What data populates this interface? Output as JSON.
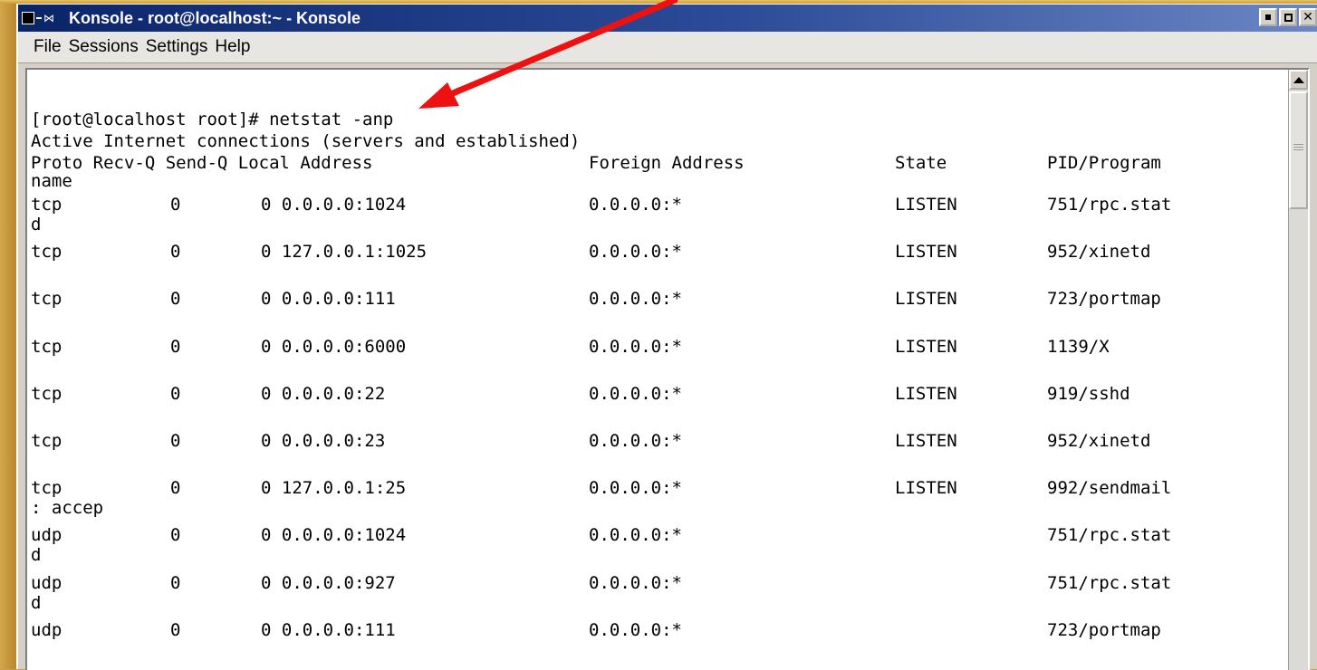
{
  "window": {
    "title": "Konsole - root@localhost:~ - Konsole",
    "title_icon_glyph": "⋈"
  },
  "menu": {
    "items": [
      "File",
      "Sessions",
      "Settings",
      "Help"
    ]
  },
  "terminal": {
    "prompt_line": "[root@localhost root]# netstat -anp",
    "header_line": "Active Internet connections (servers and established)",
    "column_headers": {
      "proto_recv_send_local": "Proto Recv-Q Send-Q Local Address",
      "foreign": "Foreign Address",
      "state": "State",
      "pid": "PID/Program"
    },
    "header_wrap": "name",
    "rows": [
      {
        "proto": "tcp",
        "recvq": "0",
        "sendq_local": "0 0.0.0.0:1024",
        "foreign": "0.0.0.0:*",
        "state": "LISTEN",
        "pid": "751/rpc.stat",
        "wrap": "d"
      },
      {
        "proto": "tcp",
        "recvq": "0",
        "sendq_local": "0 127.0.0.1:1025",
        "foreign": "0.0.0.0:*",
        "state": "LISTEN",
        "pid": "952/xinetd",
        "wrap": ""
      },
      {
        "proto": "tcp",
        "recvq": "0",
        "sendq_local": "0 0.0.0.0:111",
        "foreign": "0.0.0.0:*",
        "state": "LISTEN",
        "pid": "723/portmap",
        "wrap": ""
      },
      {
        "proto": "tcp",
        "recvq": "0",
        "sendq_local": "0 0.0.0.0:6000",
        "foreign": "0.0.0.0:*",
        "state": "LISTEN",
        "pid": "1139/X",
        "wrap": ""
      },
      {
        "proto": "tcp",
        "recvq": "0",
        "sendq_local": "0 0.0.0.0:22",
        "foreign": "0.0.0.0:*",
        "state": "LISTEN",
        "pid": "919/sshd",
        "wrap": ""
      },
      {
        "proto": "tcp",
        "recvq": "0",
        "sendq_local": "0 0.0.0.0:23",
        "foreign": "0.0.0.0:*",
        "state": "LISTEN",
        "pid": "952/xinetd",
        "wrap": ""
      },
      {
        "proto": "tcp",
        "recvq": "0",
        "sendq_local": "0 127.0.0.1:25",
        "foreign": "0.0.0.0:*",
        "state": "LISTEN",
        "pid": "992/sendmail",
        "wrap": ": accep"
      },
      {
        "proto": "udp",
        "recvq": "0",
        "sendq_local": "0 0.0.0.0:1024",
        "foreign": "0.0.0.0:*",
        "state": "",
        "pid": "751/rpc.stat",
        "wrap": "d"
      },
      {
        "proto": "udp",
        "recvq": "0",
        "sendq_local": "0 0.0.0.0:927",
        "foreign": "0.0.0.0:*",
        "state": "",
        "pid": "751/rpc.stat",
        "wrap": "d"
      },
      {
        "proto": "udp",
        "recvq": "0",
        "sendq_local": "0 0.0.0.0:111",
        "foreign": "0.0.0.0:*",
        "state": "",
        "pid": "723/portmap",
        "wrap": ""
      }
    ]
  },
  "colors": {
    "titlebar_start": "#0a246a",
    "titlebar_end": "#6b86c4",
    "annotation_arrow": "#ee1111",
    "desktop": "#c8a24a"
  },
  "icons": {
    "window_menu": "square-icon",
    "window_sticky": "bow-tie-icon",
    "minimize": "minimize-icon",
    "maximize": "maximize-icon",
    "close": "close-icon",
    "scroll_up": "arrow-up-icon"
  },
  "annotation": {
    "type": "arrow",
    "points_to": "netstat -anp"
  }
}
